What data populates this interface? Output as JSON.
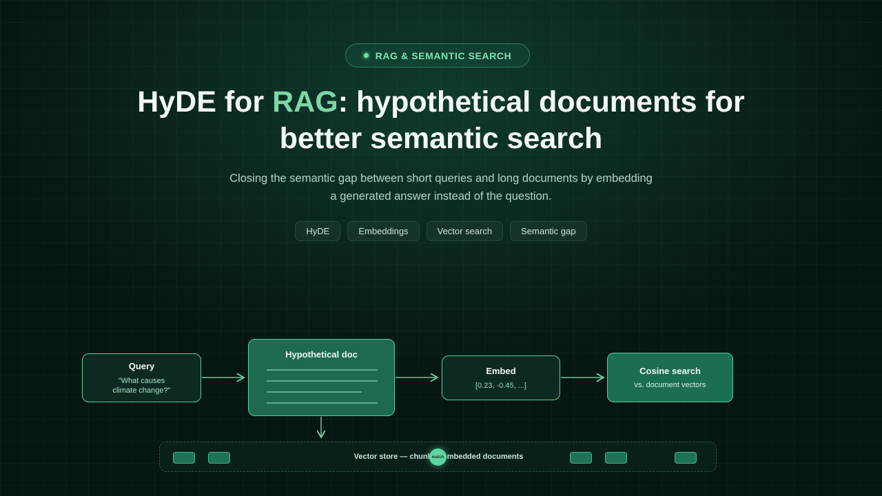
{
  "badge": {
    "label": "RAG & SEMANTIC SEARCH"
  },
  "title": {
    "part1": "HyDE for ",
    "accent": "RAG",
    "part2": ": hypothetical documents for",
    "line2": "better semantic search"
  },
  "subtitle": {
    "line1": "Closing the semantic gap between short queries and long documents by embedding",
    "line2": "a generated answer instead of the question."
  },
  "tags": [
    "HyDE",
    "Embeddings",
    "Vector search",
    "Semantic gap"
  ],
  "diagram": {
    "query": {
      "title": "Query",
      "text_line1": "\"What causes",
      "text_line2": "climate change?\""
    },
    "hypothetical": {
      "title": "Hypothetical doc"
    },
    "embed": {
      "title": "Embed",
      "text": "[0.23, -0.45, ...]"
    },
    "cosine": {
      "title": "Cosine search",
      "text": "vs. document vectors"
    },
    "store": {
      "label": "Vector store — chunked embedded documents",
      "match_label": "match"
    }
  },
  "colors": {
    "accent": "#7fd6a6",
    "node_border": "#5bcf9a",
    "node_fill_dark": "#0d2a22",
    "node_fill_green": "#1d6a51"
  }
}
